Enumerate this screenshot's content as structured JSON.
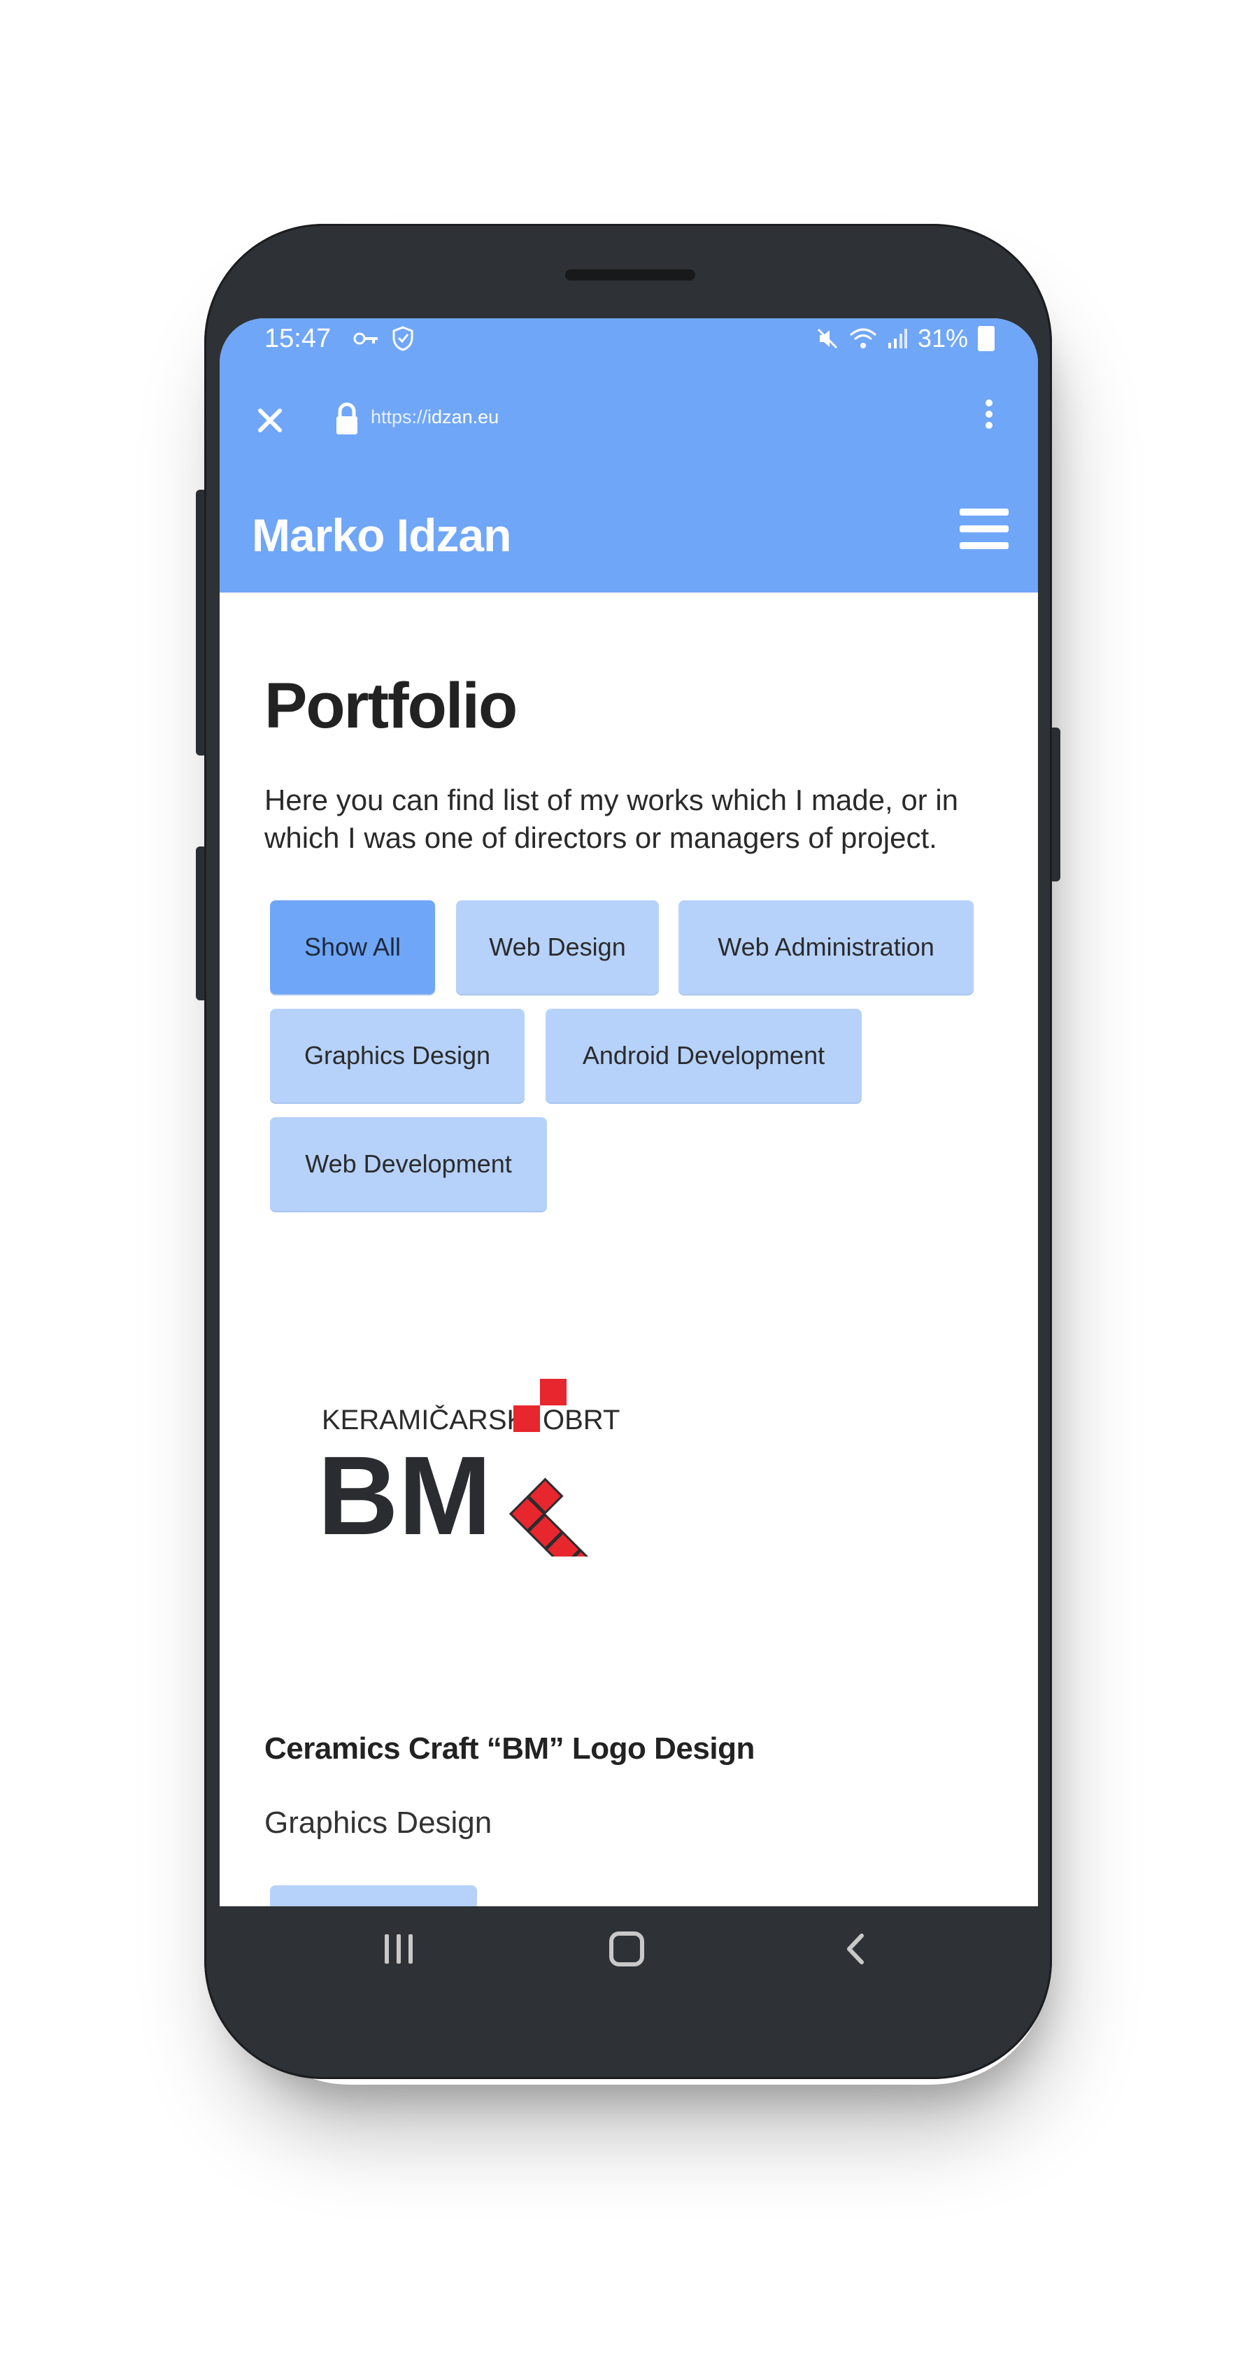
{
  "status_bar": {
    "time": "15:47",
    "left_icons": [
      "vpn-key-icon",
      "shield-icon"
    ],
    "right_icons": [
      "mute-icon",
      "wifi-icon",
      "signal-icon"
    ],
    "battery": "31%"
  },
  "browser": {
    "url_prefix": "https://",
    "url_domain": "idzan.eu",
    "icons": [
      "close-icon",
      "lock-icon",
      "more-vert-icon"
    ]
  },
  "site": {
    "brand": "Marko Idzan",
    "menu_icon": "hamburger-icon"
  },
  "page": {
    "title": "Portfolio",
    "intro": "Here you can find list of my works which I made, or in which I was one of directors or managers of project."
  },
  "filters": [
    {
      "label": "Show All",
      "active": true
    },
    {
      "label": "Web Design",
      "active": false
    },
    {
      "label": "Web Administration",
      "active": false
    },
    {
      "label": "Graphics Design",
      "active": false
    },
    {
      "label": "Android Development",
      "active": false
    },
    {
      "label": "Web Development",
      "active": false
    }
  ],
  "portfolio_item": {
    "logo_line1_a": "KERAMIČARSKI",
    "logo_line1_b": "OBRT",
    "logo_mark": "BM",
    "title": "Ceramics Craft “BM” Logo Design",
    "category": "Graphics Design"
  },
  "colors": {
    "primary": "#6fa6f8",
    "chip": "#b6d2fb",
    "text": "#222222",
    "logo_red": "#e8262d"
  },
  "nav_bar": [
    "recent-apps-icon",
    "home-icon",
    "back-icon"
  ]
}
